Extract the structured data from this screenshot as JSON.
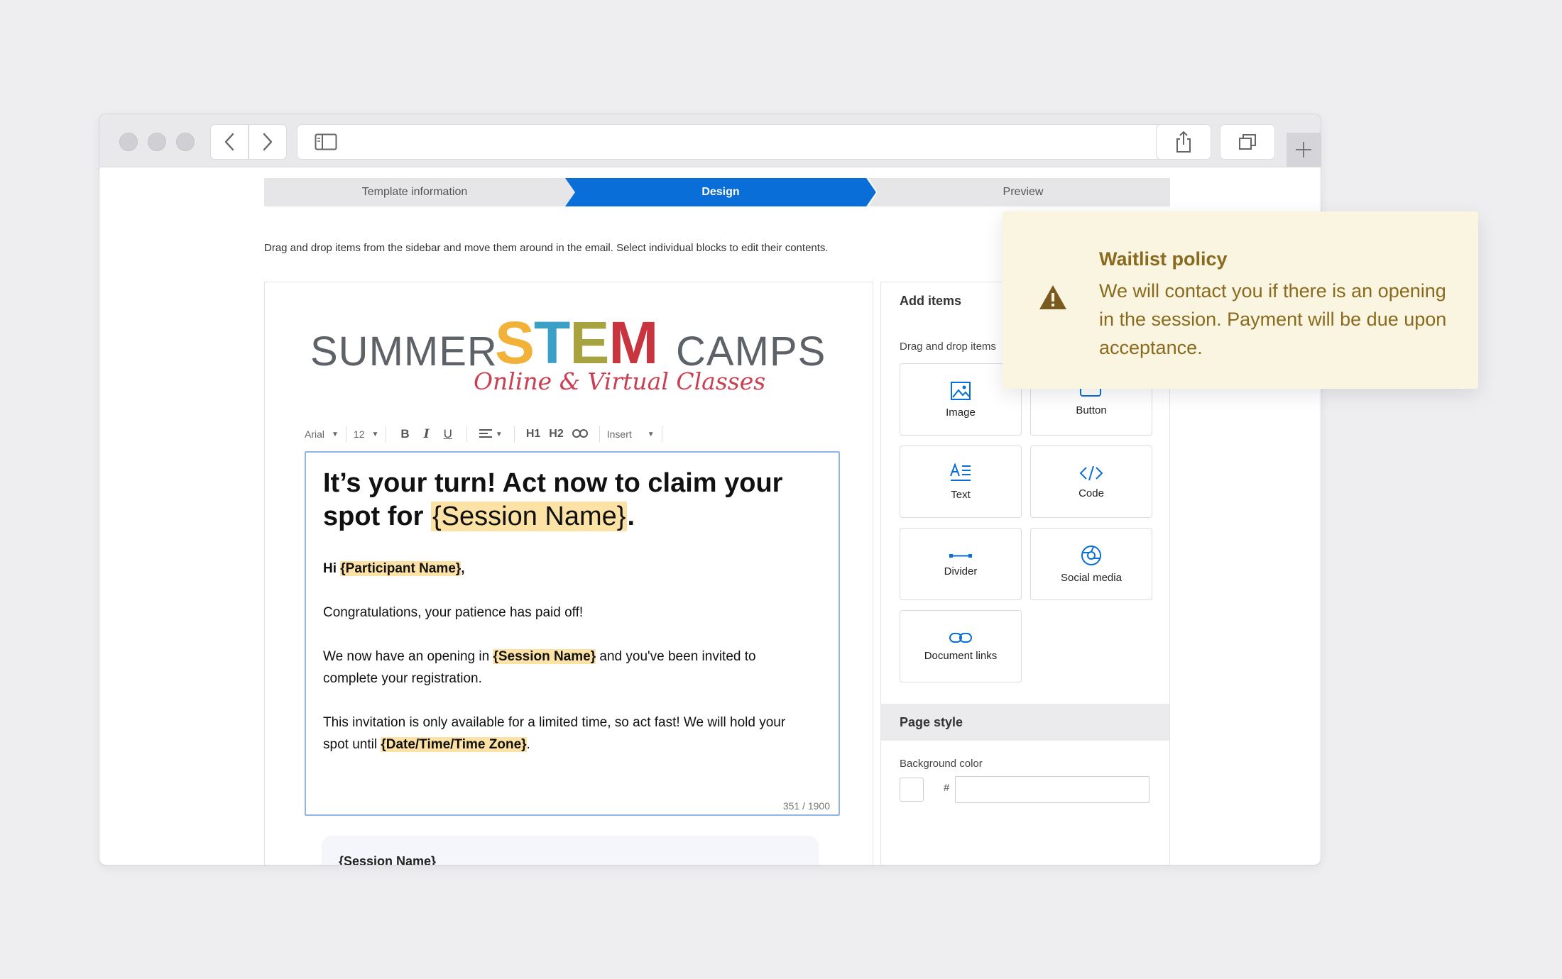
{
  "stepper": {
    "steps": [
      {
        "label": "Template information",
        "active": false
      },
      {
        "label": "Design",
        "active": true
      },
      {
        "label": "Preview",
        "active": false
      }
    ],
    "active_color": "#0a6ed8"
  },
  "instructions": "Drag and drop items from the sidebar and move them around in the email. Select individual blocks to edit their contents.",
  "logo": {
    "word_left": "SUMMER",
    "word_stem": "STEM",
    "word_right": "CAMPS",
    "tagline": "Online & Virtual Classes"
  },
  "toolbar": {
    "font": "Arial",
    "size": "12",
    "bold": "B",
    "italic": "I",
    "underline": "U",
    "h1": "H1",
    "h2": "H2",
    "insert": "Insert"
  },
  "editor": {
    "heading_pre": "It’s your turn! Act now to claim your",
    "heading_line2_pre": "spot for ",
    "heading_token": "{Session Name}",
    "heading_post": ".",
    "greeting_pre": "Hi ",
    "greeting_token": "{Participant Name}",
    "greeting_post": ",",
    "para1": "Congratulations, your patience has paid off!",
    "para2_pre": "We now have an opening in ",
    "para2_token": "{Session Name}",
    "para2_mid": " and you've been invited to",
    "para2_line2": "complete your registration.",
    "para3_line1": "This invitation is only available for a limited time, so act fast! We will hold your",
    "para3_pre": "spot until ",
    "para3_token": "{Date/Time/Time Zone}",
    "para3_post": ".",
    "char_count": "351 / 1900"
  },
  "below_card": {
    "title": "{Session Name}"
  },
  "sidebar": {
    "add_items_title": "Add items",
    "drag_label": "Drag and drop items",
    "items": [
      {
        "label": "Image",
        "icon": "image-icon"
      },
      {
        "label": "Button",
        "icon": "button-icon"
      },
      {
        "label": "Text",
        "icon": "text-icon"
      },
      {
        "label": "Code",
        "icon": "code-icon"
      },
      {
        "label": "Divider",
        "icon": "divider-icon"
      },
      {
        "label": "Social media",
        "icon": "social-media-icon"
      },
      {
        "label": "Document links",
        "icon": "link-icon"
      }
    ],
    "page_style_title": "Page style",
    "bg_color_label": "Background color",
    "hash": "#",
    "bg_color_value": ""
  },
  "notice": {
    "title": "Waitlist policy",
    "body_line1": "We will contact you if there is an opening",
    "body_line2": "in the session. Payment will be due upon",
    "body_line3": "acceptance.",
    "text_color": "#8a6a1e",
    "bg_color": "#f9f5e0"
  }
}
